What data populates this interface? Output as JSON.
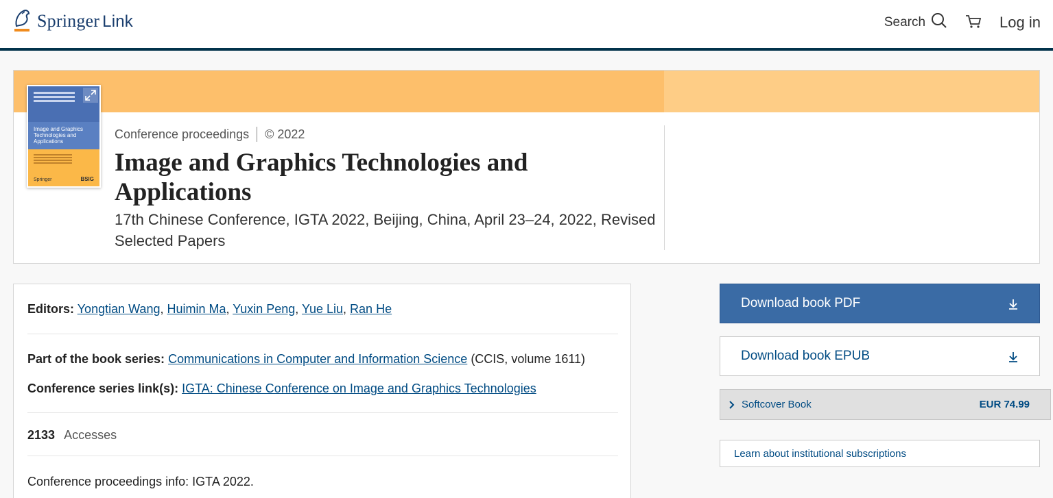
{
  "header": {
    "logo_primary": "Springer",
    "logo_secondary": "Link",
    "search_label": "Search",
    "login_label": "Log in",
    "colors": {
      "header_rule": "#01324b",
      "brand": "#1a3e6e"
    }
  },
  "hero": {
    "content_type": "Conference proceedings",
    "copyright": "© 2022",
    "title": "Image and Graphics Technologies and Applications",
    "subtitle": "17th Chinese Conference, IGTA 2022, Beijing, China, April 23–24, 2022, Revised Selected Papers",
    "cover": {
      "title_text": "Image and Graphics Technologies and Applications",
      "publisher_mark": "Springer",
      "partner_mark": "BSIG"
    },
    "colors": {
      "band": "#fdbf6b",
      "band_light": "#fecd86"
    }
  },
  "info": {
    "editors_label": "Editors:",
    "editors": [
      "Yongtian Wang",
      "Huimin Ma",
      "Yuxin Peng",
      "Yue Liu",
      "Ran He"
    ],
    "series_label": "Part of the book series:",
    "series_name": "Communications in Computer and Information Science",
    "series_suffix": "(CCIS, volume 1611)",
    "conf_label": "Conference series link(s):",
    "conf_link": "IGTA: Chinese Conference on Image and Graphics Technologies",
    "accesses_count": "2133",
    "accesses_label": "Accesses",
    "proceedings_info": "Conference proceedings info: IGTA 2022."
  },
  "purchase": {
    "pdf_label": "Download book PDF",
    "epub_label": "Download book EPUB",
    "softcover_label": "Softcover Book",
    "softcover_price": "EUR 74.99",
    "institutional_label": "Learn about institutional subscriptions",
    "colors": {
      "primary_button": "#3a6ba5",
      "link": "#004b83"
    }
  }
}
